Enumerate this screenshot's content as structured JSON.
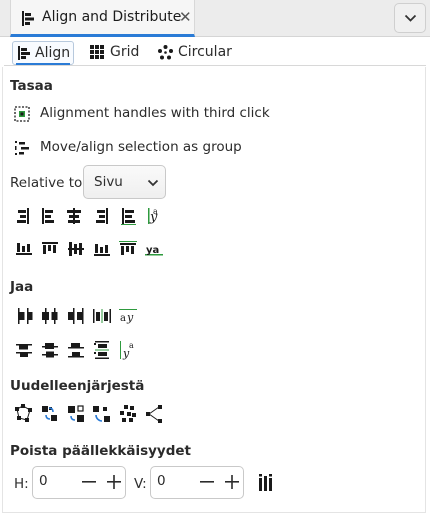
{
  "dock": {
    "tab_title": "Align and Distribute",
    "close_glyph": "✕",
    "tab_icon": "align-distribute-icon",
    "menu_icon": "chevron-down-icon"
  },
  "subtabs": [
    {
      "label": "Align",
      "icon": "align-left-icon",
      "active": true
    },
    {
      "label": "Grid",
      "icon": "grid-icon",
      "active": false
    },
    {
      "label": "Circular",
      "icon": "circular-icon",
      "active": false
    }
  ],
  "align": {
    "title": "Tasaa",
    "handles_label": "Alignment handles with third click",
    "group_label": "Move/align selection as group",
    "relative_label": "Relative to:",
    "relative_value": "Sivu"
  },
  "distribute": {
    "title": "Jaa"
  },
  "rearrange": {
    "title": "Uudelleenjärjestä"
  },
  "overlap": {
    "title": "Poista päällekkäisyydet",
    "h_label": "H:",
    "h_value": "0",
    "v_label": "V:",
    "v_value": "0"
  },
  "colors": {
    "accent": "#2a7bd6",
    "icon": "#1a1a1a",
    "icon_accent": "#2e9a3e"
  }
}
